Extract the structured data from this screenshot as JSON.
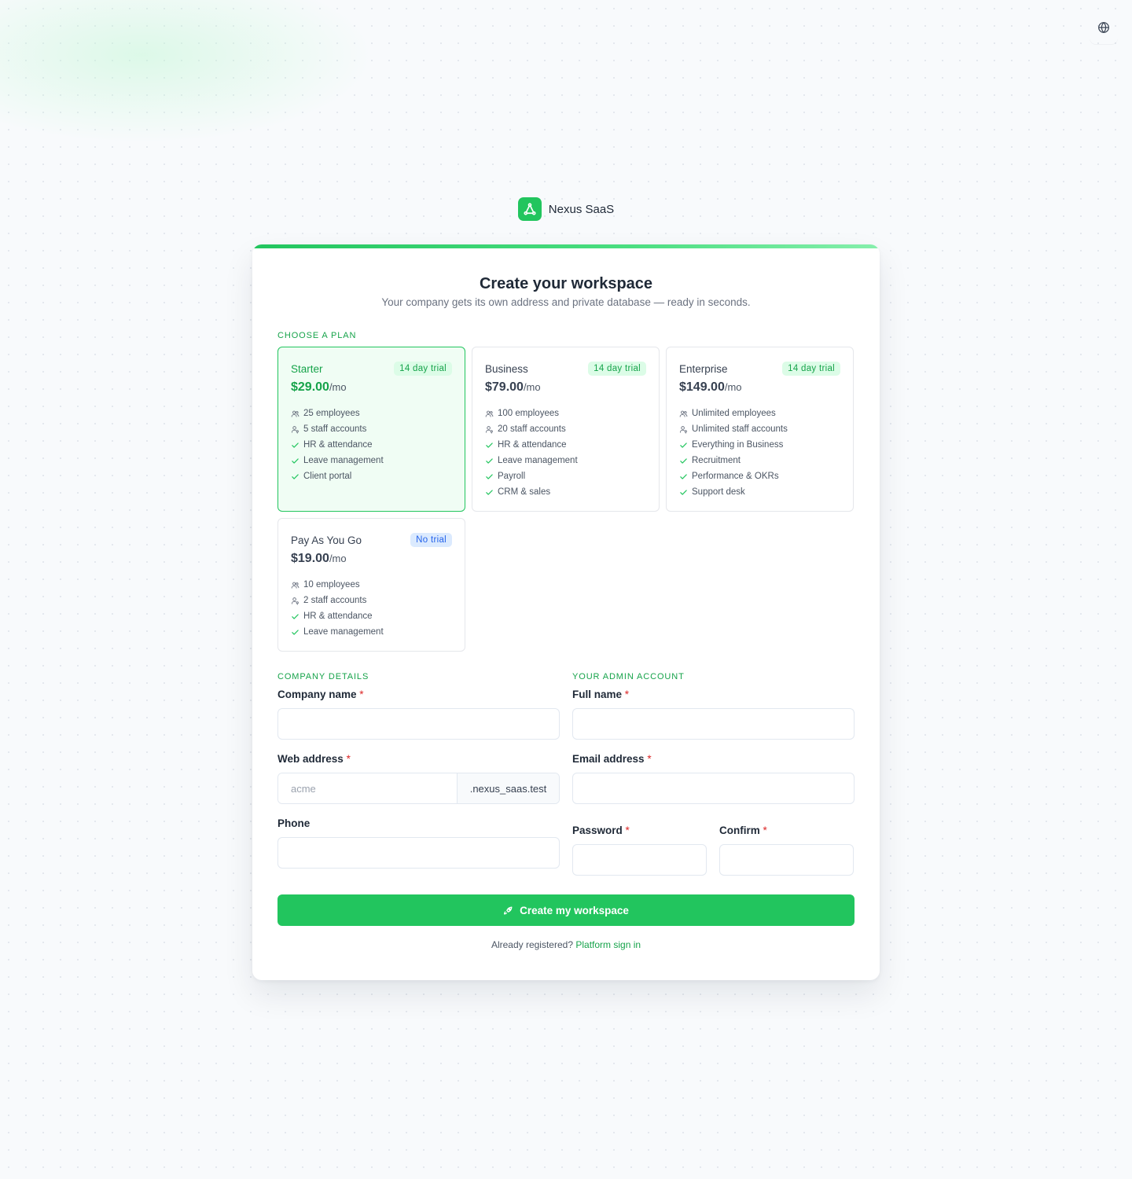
{
  "brand": {
    "name": "Nexus SaaS",
    "logo_icon": "nexus-logo-icon",
    "accent": "#22c55e"
  },
  "header": {
    "language_icon": "globe-icon"
  },
  "card": {
    "title": "Create your workspace",
    "subtitle": "Your company gets its own address and private database — ready in seconds."
  },
  "plans_section": {
    "label": "CHOOSE A PLAN",
    "plans": [
      {
        "name": "Starter",
        "badge": "14 day trial",
        "price": "$29.00",
        "unit": "/mo",
        "selected": true,
        "features": [
          {
            "icon": "users-icon",
            "text": "25 employees"
          },
          {
            "icon": "user-key-icon",
            "text": "5 staff accounts"
          },
          {
            "icon": "check-icon",
            "text": "HR & attendance"
          },
          {
            "icon": "check-icon",
            "text": "Leave management"
          },
          {
            "icon": "check-icon",
            "text": "Client portal"
          }
        ]
      },
      {
        "name": "Business",
        "badge": "14 day trial",
        "price": "$79.00",
        "unit": "/mo",
        "selected": false,
        "features": [
          {
            "icon": "users-icon",
            "text": "100 employees"
          },
          {
            "icon": "user-key-icon",
            "text": "20 staff accounts"
          },
          {
            "icon": "check-icon",
            "text": "HR & attendance"
          },
          {
            "icon": "check-icon",
            "text": "Leave management"
          },
          {
            "icon": "check-icon",
            "text": "Payroll"
          },
          {
            "icon": "check-icon",
            "text": "CRM & sales"
          }
        ]
      },
      {
        "name": "Enterprise",
        "badge": "14 day trial",
        "price": "$149.00",
        "unit": "/mo",
        "selected": false,
        "features": [
          {
            "icon": "users-icon",
            "text": "Unlimited employees"
          },
          {
            "icon": "user-key-icon",
            "text": "Unlimited staff accounts"
          },
          {
            "icon": "check-icon",
            "text": "Everything in Business"
          },
          {
            "icon": "check-icon",
            "text": "Recruitment"
          },
          {
            "icon": "check-icon",
            "text": "Performance & OKRs"
          },
          {
            "icon": "check-icon",
            "text": "Support desk"
          }
        ]
      },
      {
        "name": "Pay As You Go",
        "badge": "No trial",
        "price": "$19.00",
        "unit": "/mo",
        "selected": false,
        "features": [
          {
            "icon": "users-icon",
            "text": "10 employees"
          },
          {
            "icon": "user-key-icon",
            "text": "2 staff accounts"
          },
          {
            "icon": "check-icon",
            "text": "HR & attendance"
          },
          {
            "icon": "check-icon",
            "text": "Leave management"
          }
        ]
      }
    ]
  },
  "company": {
    "label": "COMPANY DETAILS",
    "company_name": {
      "label": "Company name",
      "value": "",
      "placeholder": ""
    },
    "web_address": {
      "label": "Web address",
      "value": "",
      "placeholder": "acme",
      "suffix": ".nexus_saas.test"
    },
    "phone": {
      "label": "Phone",
      "value": "",
      "placeholder": ""
    }
  },
  "admin": {
    "label": "YOUR ADMIN ACCOUNT",
    "full_name": {
      "label": "Full name",
      "value": "",
      "placeholder": ""
    },
    "email": {
      "label": "Email address",
      "value": "",
      "placeholder": ""
    },
    "password": {
      "label": "Password",
      "value": "",
      "placeholder": ""
    },
    "confirm": {
      "label": "Confirm",
      "value": "",
      "placeholder": ""
    }
  },
  "required_marker": "*",
  "submit": {
    "label": "Create my workspace",
    "icon": "rocket-icon"
  },
  "footer": {
    "text": "Already registered?",
    "link": "Platform sign in"
  }
}
